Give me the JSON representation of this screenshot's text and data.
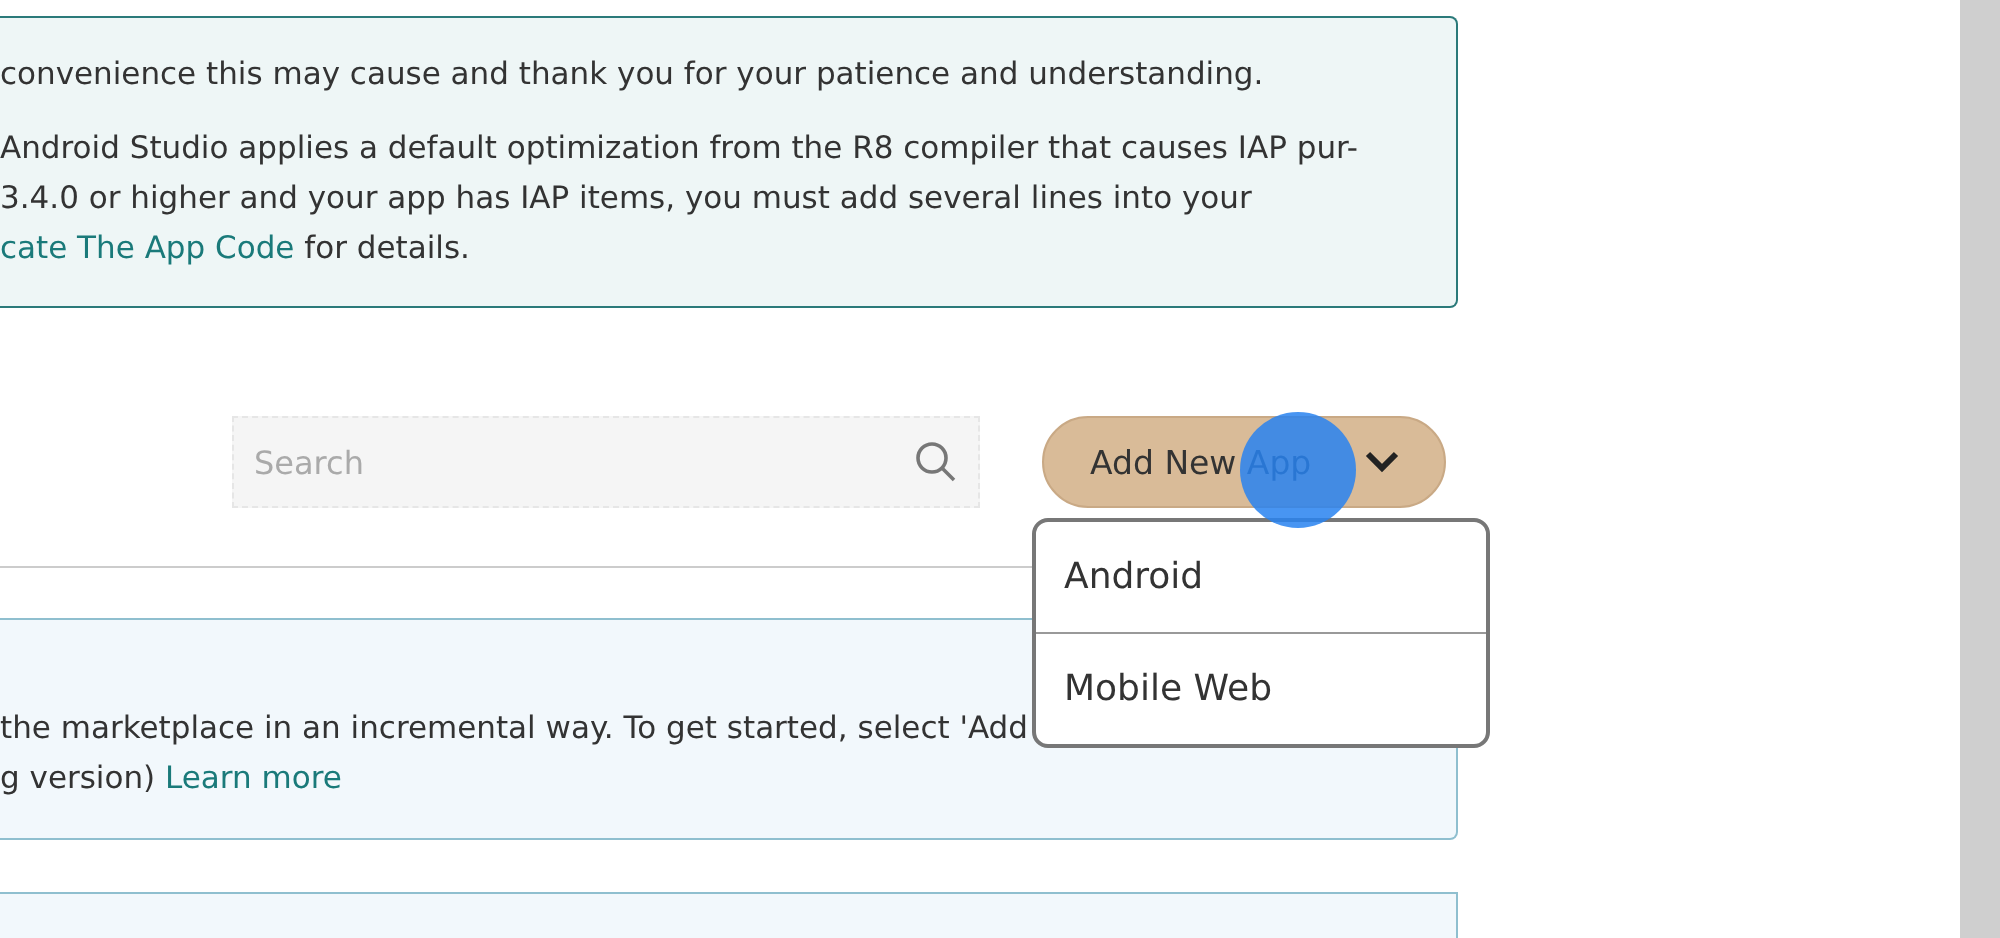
{
  "notice": {
    "paragraphs": [
      {
        "lines": [
          {
            "text": "convenience this may cause and thank you for your patience and understanding."
          }
        ]
      },
      {
        "lines": [
          {
            "text": "Android Studio applies a default optimization from the R8 compiler that causes IAP pur-"
          },
          {
            "text": "3.4.0 or higher and your app has IAP items, you must add several lines into your"
          },
          {
            "link": "cate The App Code",
            "text": " for details."
          }
        ]
      }
    ]
  },
  "search": {
    "placeholder": "Search"
  },
  "add_button": {
    "label": "Add New App",
    "expanded": true
  },
  "menu": {
    "items": [
      "Android",
      "Mobile Web"
    ]
  },
  "info": {
    "lines": [
      {
        "text": "the marketplace in an incremental way. To get started, select 'Add"
      },
      {
        "text": "g version)",
        "link": "Learn more"
      }
    ]
  }
}
